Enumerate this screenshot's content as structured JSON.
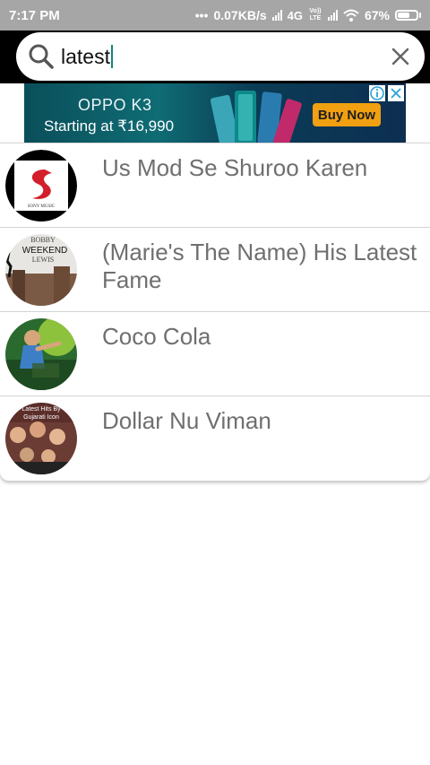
{
  "status_bar": {
    "time": "7:17 PM",
    "speed": "0.07KB/s",
    "network_4g": "4G",
    "volte_label": "Vo)) LTE",
    "battery": "67%",
    "battery_level": 0.67
  },
  "search": {
    "query": "latest"
  },
  "ad": {
    "brand": "OPPO K3",
    "price_text": "Starting at ₹16,990",
    "cta": "Buy Now"
  },
  "results": [
    {
      "title": "Us Mod Se Shuroo Karen",
      "thumb_text": "SONY MUSIC"
    },
    {
      "title_line1": "(Marie's The Name) His Latest",
      "title_line2": "Fame",
      "thumb_text": [
        "BOBBY",
        "WEEKEND",
        "LEWIS"
      ]
    },
    {
      "title": "Coco Cola"
    },
    {
      "title": "Dollar Nu Viman",
      "thumb_text": [
        "Latest Hits By",
        "Gujarati Icon"
      ]
    }
  ]
}
